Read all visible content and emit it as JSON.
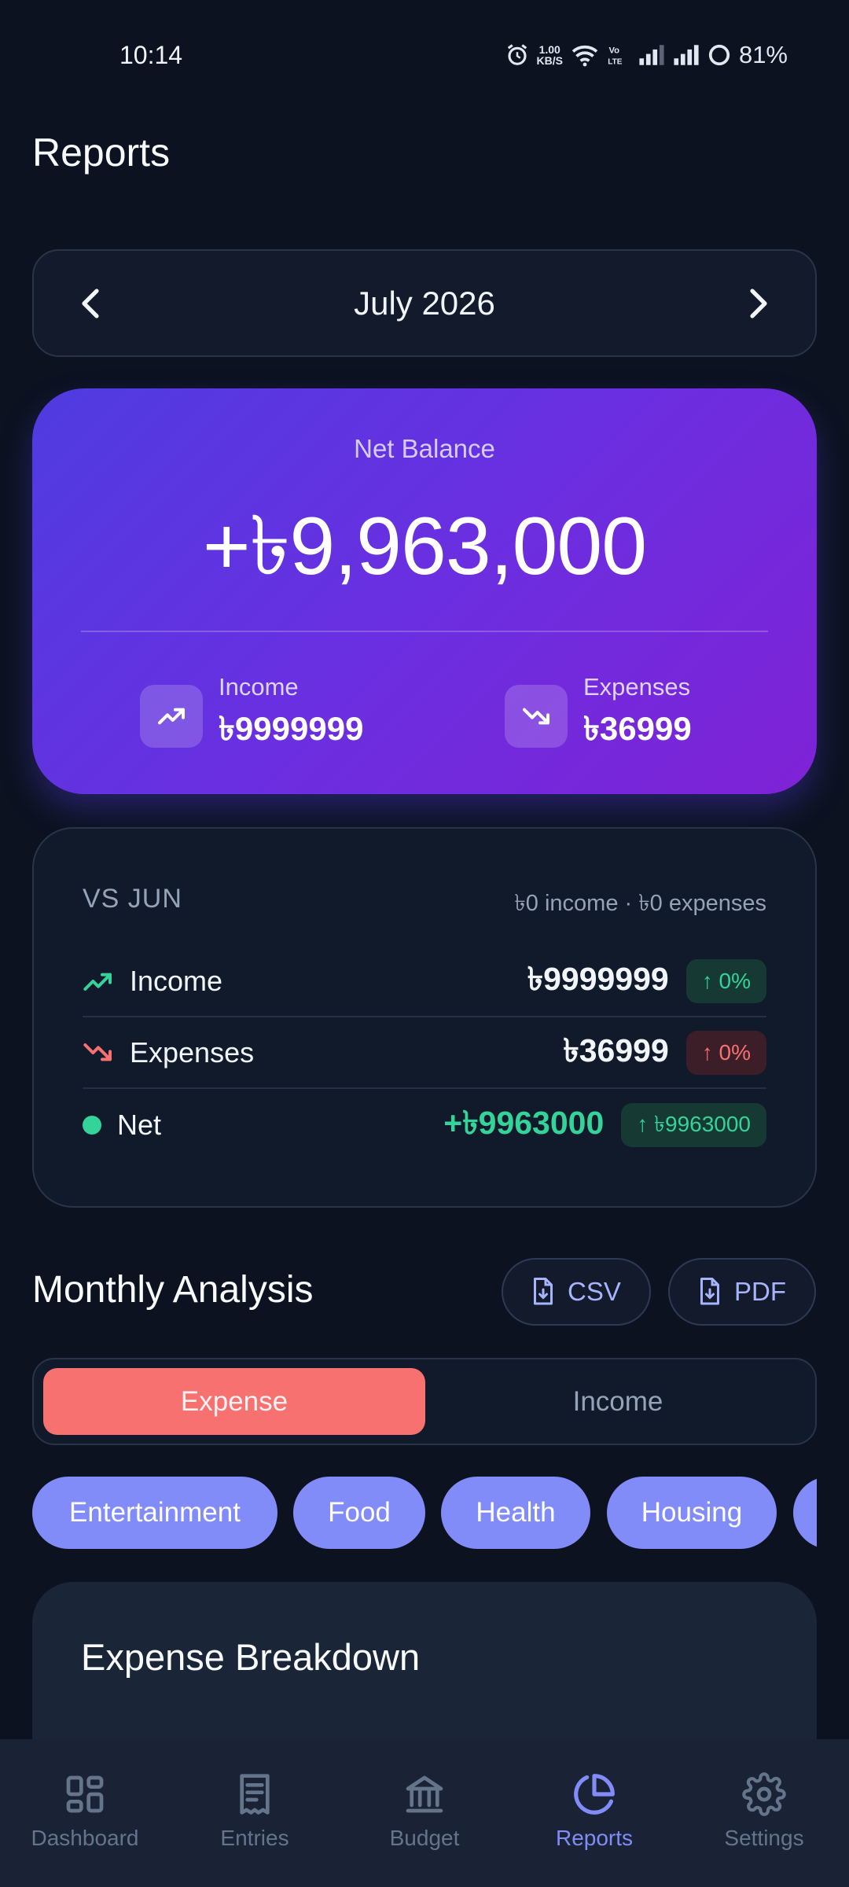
{
  "status_bar": {
    "time": "10:14",
    "net_speed_top": "1.00",
    "net_speed_bottom": "KB/S",
    "battery": "81%"
  },
  "header": {
    "title": "Reports"
  },
  "month_nav": {
    "label": "July 2026"
  },
  "balance": {
    "label": "Net Balance",
    "value": "+৳9,963,000",
    "income_label": "Income",
    "income_value": "৳9999999",
    "expenses_label": "Expenses",
    "expenses_value": "৳36999"
  },
  "comparison": {
    "title": "VS JUN",
    "summary": "৳0 income · ৳0 expenses",
    "rows": [
      {
        "name": "Income",
        "amount": "৳9999999",
        "badge": "↑ 0%"
      },
      {
        "name": "Expenses",
        "amount": "৳36999",
        "badge": "↑ 0%"
      },
      {
        "name": "Net",
        "amount": "+৳9963000",
        "badge": "↑ ৳9963000"
      }
    ]
  },
  "analysis": {
    "title": "Monthly Analysis",
    "csv_label": "CSV",
    "pdf_label": "PDF",
    "tabs": [
      "Expense",
      "Income"
    ],
    "active_tab": "Expense",
    "categories": [
      "Entertainment",
      "Food",
      "Health",
      "Housing",
      ""
    ]
  },
  "breakdown": {
    "title": "Expense Breakdown"
  },
  "bottom_nav": {
    "items": [
      "Dashboard",
      "Entries",
      "Budget",
      "Reports",
      "Settings"
    ],
    "active": "Reports"
  },
  "colors": {
    "background": "#0c1220",
    "accent": "#818cf8",
    "income_green": "#34d399",
    "expense_red": "#f87171",
    "card_gradient_start": "#4f3ce0",
    "card_gradient_end": "#7f22d6"
  }
}
